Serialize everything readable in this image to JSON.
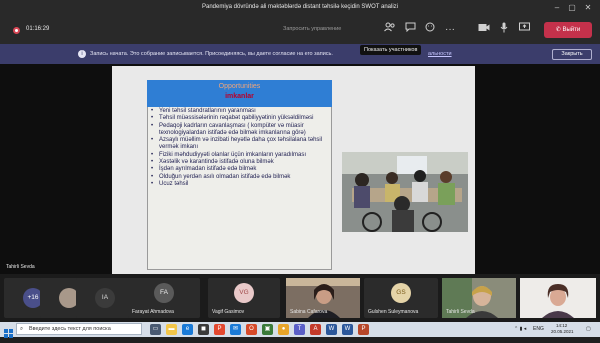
{
  "window": {
    "title": "Pandemiya dövründə ali məktəblərdə distant təhsilə keçidin SWOT analizi"
  },
  "toolbar": {
    "timer": "01:16:29",
    "manage_recording_label": "Запросить управление",
    "leave_label": "Выйти"
  },
  "banner": {
    "message": "Запись начата. Это собрание записывается. Присоединяясь, вы даете согласие на его запись.",
    "privacy_link": "альности",
    "close_label": "Закрыть"
  },
  "tooltip": {
    "text": "Показать участников"
  },
  "slide": {
    "title_line1": "Opportunities",
    "title_line2": "imkanlar",
    "bullets": [
      "Yeni təhsil standratlarının yaranması",
      "Təhsil müəssisələrinin rəqabət qabiliyyətinin yüksəldilməsi",
      "Pedaqoji kadrların cavanlaşması ( kompüter və müasir texnologiyalardan istifadə edə bilmək imkanlarına görə)",
      "Azsaylı müəllim və inzibati heyətlə daha çox təhsilalana təhsil vermək imkanı",
      "Fiziki məhdudiyyəti olanlar üçün imkanların yaradılması",
      "Xəstəlik və karantində istifadə oluna bilmək",
      "İşdən ayrılmadan istifadə edə bilmək",
      "Olduğun yerdən asılı olmadan istifadə edə bilmək",
      "Ucuz təhsil"
    ]
  },
  "speaker": {
    "name": "Tahirli Sevda"
  },
  "participants": [
    {
      "initials": "+16",
      "name": ""
    },
    {
      "initials": "",
      "name": ""
    },
    {
      "initials": "IA",
      "name": ""
    },
    {
      "initials": "FA",
      "name": "Farayat Ahmadova"
    },
    {
      "initials": "VG",
      "name": "Vagif Gasimov"
    },
    {
      "initials": "",
      "name": "Sabina Cafarova"
    },
    {
      "initials": "GS",
      "name": "Gulshen Suleymanova"
    },
    {
      "initials": "",
      "name": "Tahirli Sevda"
    }
  ],
  "taskbar": {
    "search_placeholder": "Введите здесь текст для поиска",
    "lang": "ENG",
    "time": "14:12",
    "date": "20.05.2021"
  },
  "colors": {
    "accent": "#3b3d6b",
    "leave": "#c4314b",
    "slide_header": "#2f7ed4"
  }
}
